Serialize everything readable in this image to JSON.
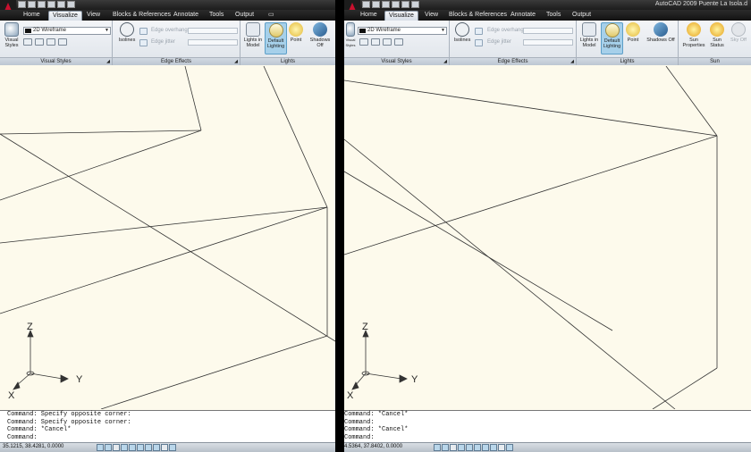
{
  "colors": {
    "accent": "#a6d0ea",
    "viewport_bg": "#fdfaec",
    "app_red": "#c8102e"
  },
  "left": {
    "title": "",
    "tabs": [
      "Home",
      "Visualize",
      "View",
      "Blocks & References",
      "Annotate",
      "Tools",
      "Output"
    ],
    "active_tab": "Visualize",
    "visual_styles": {
      "button_label": "Visual Styles",
      "combo_value": "2D Wireframe",
      "panel_title": "Visual Styles"
    },
    "edge_effects": {
      "isolines_label": "Isolines",
      "edge_overhang": "Edge overhang",
      "edge_jitter": "Edge jitter",
      "panel_title": "Edge Effects"
    },
    "lights": {
      "lights_in_model": "Lights in Model",
      "default_lighting": "Default Lighting",
      "point": "Point",
      "shadows": "Shadows Off",
      "panel_title": "Lights"
    },
    "ucs": {
      "z": "Z",
      "y": "Y",
      "x": "X"
    },
    "command_lines": [
      "Command: Specify opposite corner:",
      "Command: Specify opposite corner:",
      "Command: *Cancel*",
      "Command:"
    ],
    "coords": "35.1215, 38.4281, 0.0000"
  },
  "right": {
    "title": "AutoCAD 2009 Puente La Isola.d",
    "tabs": [
      "Home",
      "Visualize",
      "View",
      "Blocks & References",
      "Annotate",
      "Tools",
      "Output"
    ],
    "active_tab": "Visualize",
    "visual_styles": {
      "button_label": "Visual Styles",
      "combo_value": "2D Wireframe",
      "panel_title": "Visual Styles"
    },
    "edge_effects": {
      "isolines_label": "Isolines",
      "edge_overhang": "Edge overhang",
      "edge_jitter": "Edge jitter",
      "panel_title": "Edge Effects"
    },
    "lights": {
      "lights_in_model": "Lights in Model",
      "default_lighting": "Default Lighting",
      "point": "Point",
      "shadows": "Shadows Off",
      "panel_title": "Lights"
    },
    "sun": {
      "sun_properties": "Sun Properties",
      "sun_status": "Sun Status",
      "sky_off": "Sky Off",
      "panel_title": "Sun"
    },
    "ucs": {
      "z": "Z",
      "y": "Y",
      "x": "X"
    },
    "command_lines": [
      "Command: *Cancel*",
      "Command:",
      "Command: *Cancel*",
      "Command:"
    ],
    "coords": "4.5364, 37.8402, 0.0000"
  }
}
